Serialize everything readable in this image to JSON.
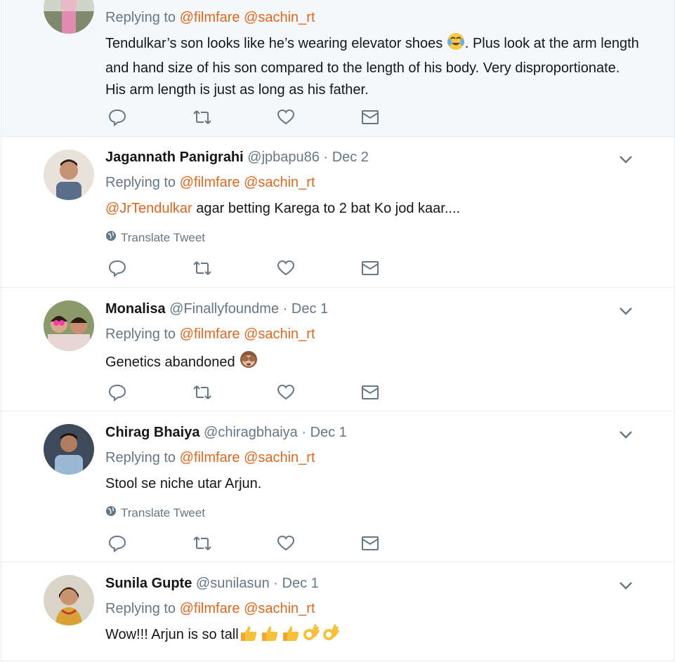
{
  "tweets": [
    {
      "replying_label": "Replying to",
      "mentions": [
        "@filmfare",
        "@sachin_rt"
      ],
      "text_html_parts": {
        "pre": "Tendulkar’s son looks like he’s wearing elevator shoes ",
        "post": ". Plus look at the arm length and hand size of his son compared to the length of his body. Very disproportionate. His arm length is just as long as his father."
      }
    },
    {
      "name": "Jagannath Panigrahi",
      "handle": "@jpbapu86",
      "dot": "·",
      "date": "Dec 2",
      "replying_label": "Replying to",
      "mentions": [
        "@filmfare",
        "@sachin_rt"
      ],
      "inline_mention": "@JrTendulkar",
      "text": " agar betting Karega to  2 bat Ko jod kaar....",
      "translate": "Translate Tweet"
    },
    {
      "name": "Monalisa",
      "handle": "@Finallyfoundme",
      "dot": "·",
      "date": "Dec 1",
      "replying_label": "Replying to",
      "mentions": [
        "@filmfare",
        "@sachin_rt"
      ],
      "text": "Genetics abandoned "
    },
    {
      "name": "Chirag Bhaiya",
      "handle": "@chiragbhaiya",
      "dot": "·",
      "date": "Dec 1",
      "replying_label": "Replying to",
      "mentions": [
        "@filmfare",
        "@sachin_rt"
      ],
      "text": "Stool se niche utar Arjun.",
      "translate": "Translate Tweet"
    },
    {
      "name": "Sunila Gupte",
      "handle": "@sunilasun",
      "dot": "·",
      "date": "Dec 1",
      "replying_label": "Replying to",
      "mentions": [
        "@filmfare",
        "@sachin_rt"
      ],
      "text": "Wow!!! Arjun is so tall"
    }
  ],
  "icons": {
    "reply": "reply-icon",
    "retweet": "retweet-icon",
    "like": "heart-icon",
    "dm": "envelope-icon",
    "more": "chevron-down-icon",
    "globe": "globe-icon"
  },
  "colors": {
    "mention": "#e0661e",
    "meta": "#657786",
    "text": "#14171a",
    "divider": "#e6ecf0"
  }
}
